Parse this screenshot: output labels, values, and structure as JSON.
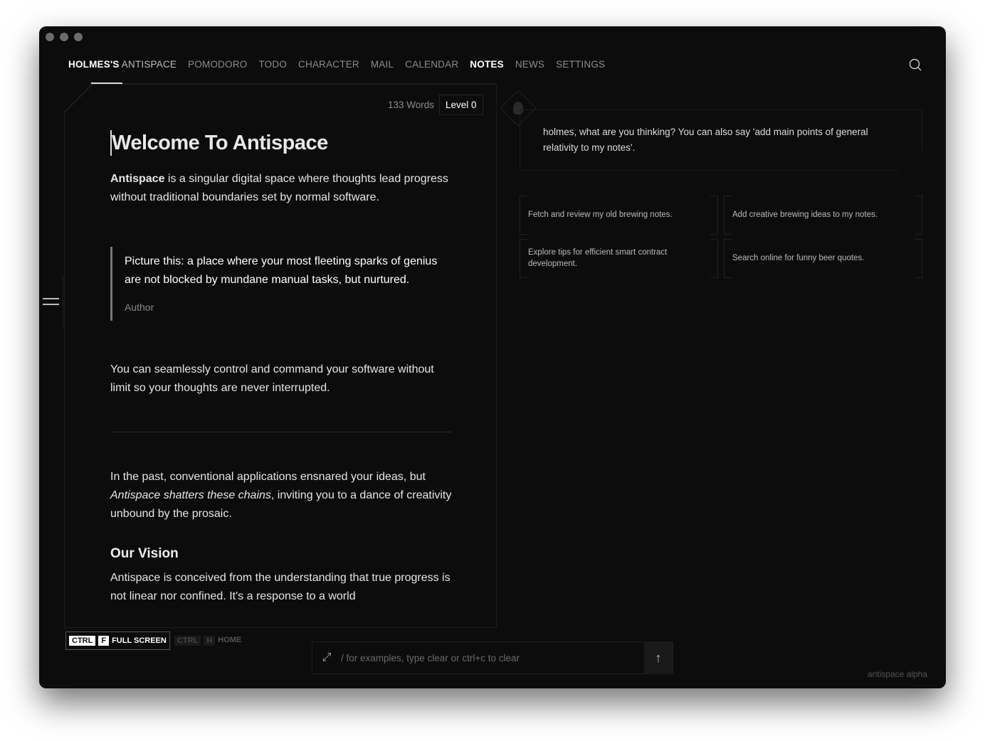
{
  "nav": {
    "brand_bold": "HOLMES'S",
    "brand_rest": "ANTISPACE",
    "items": [
      "POMODORO",
      "TODO",
      "CHARACTER",
      "MAIL",
      "CALENDAR",
      "NOTES",
      "NEWS",
      "SETTINGS"
    ],
    "active": "NOTES"
  },
  "editor": {
    "word_count": "133 Words",
    "level": "Level 0",
    "title": "Welcome To Antispace",
    "p1_bold": "Antispace",
    "p1_rest": " is a singular digital space where thoughts lead progress without traditional boundaries set by normal software.",
    "quote": "Picture this: a place where your most fleeting sparks of genius are not blocked by mundane manual tasks, but nurtured.",
    "quote_author": "Author",
    "p2": "You can seamlessly control and command your software without limit so your thoughts are never interrupted.",
    "p3_a": "In the past, conventional applications ensnared your ideas, but ",
    "p3_em": "Antispace shatters these chains",
    "p3_b": ", inviting you to a dance of creativity unbound by the prosaic.",
    "h2": "Our Vision",
    "p4": "Antispace is conceived from the understanding that true progress is not linear nor confined. It's a response to a world"
  },
  "assistant": {
    "prompt": "holmes, what are you thinking? You can also say 'add main points of general relativity to my notes'.",
    "suggestions": [
      "Fetch and review my old brewing notes.",
      "Add creative brewing ideas to my notes.",
      "Explore tips for efficient smart contract development.",
      "Search online for funny beer quotes."
    ]
  },
  "shortcuts": {
    "fullscreen": {
      "ctrl": "CTRL",
      "key": "F",
      "label": "FULL SCREEN"
    },
    "home": {
      "ctrl": "CTRL",
      "key": "H",
      "label": "HOME"
    }
  },
  "command": {
    "placeholder": "/ for examples, type clear or ctrl+c to clear"
  },
  "footer": {
    "version": "antispace alpha"
  }
}
